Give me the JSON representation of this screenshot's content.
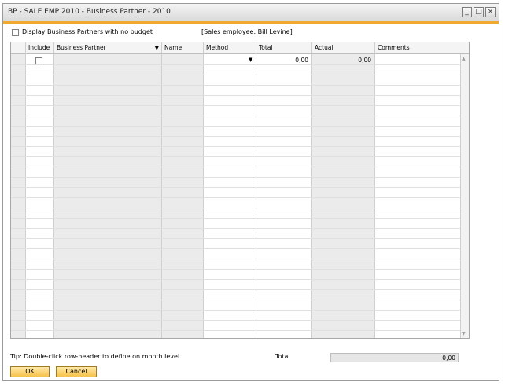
{
  "window": {
    "title": "BP - SALE EMP 2010 - Business Partner - 2010"
  },
  "options": {
    "no_budget_label": "Display Business Partners with no budget",
    "sales_employee": "[Sales employee: Bill Levine]"
  },
  "grid": {
    "columns": [
      "Include",
      "Business Partner",
      "Name",
      "Method",
      "Total",
      "Actual",
      "Comments"
    ],
    "first_row": {
      "total": "0,00",
      "actual": "0,00"
    }
  },
  "footer": {
    "tip": "Tip: Double-click row-header to define on month level.",
    "total_label": "Total",
    "total_value": "0,00"
  },
  "buttons": {
    "ok": "OK",
    "cancel": "Cancel"
  },
  "colors": {
    "accent": "#f0a830",
    "button": "#f6c24a",
    "grey_column": "#ebebeb"
  }
}
